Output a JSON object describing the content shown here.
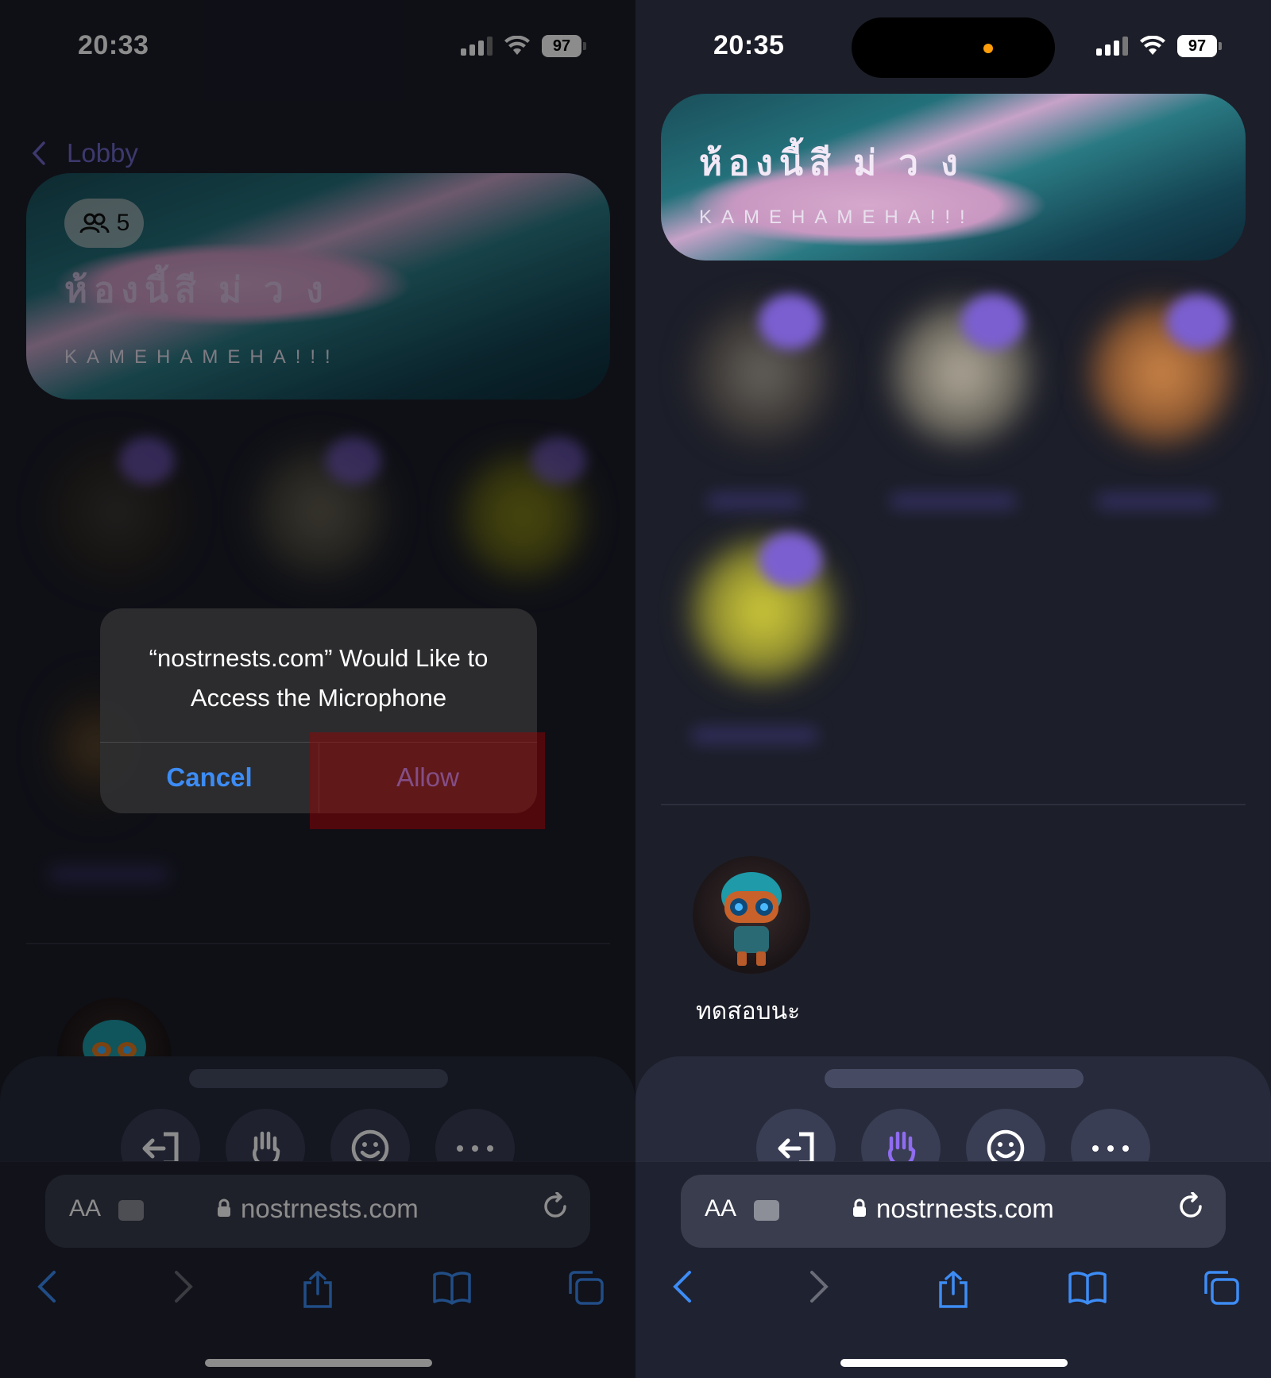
{
  "left": {
    "status": {
      "time": "20:33",
      "battery": "97"
    },
    "nav": {
      "back_label": "Lobby"
    },
    "room": {
      "listener_count": "5",
      "title": "ห้องนี้สี ม่ ว ง",
      "subtitle": "KAMEHAMEHA!!!"
    },
    "dialog": {
      "title": "“nostrnests.com” Would Like to Access the Microphone",
      "cancel_label": "Cancel",
      "allow_label": "Allow"
    },
    "browser": {
      "aa_label": "AA",
      "url": "nostrnests.com"
    }
  },
  "right": {
    "status": {
      "time": "20:35",
      "battery": "97"
    },
    "room": {
      "title": "ห้องนี้สี ม่ ว ง",
      "subtitle": "KAMEHAMEHA!!!"
    },
    "self_user": {
      "name": "ทดสอบนะ"
    },
    "browser": {
      "aa_label": "AA",
      "url": "nostrnests.com"
    }
  },
  "colors": {
    "accent_purple": "#6f68c8",
    "ios_blue": "#3d8cf5",
    "hand_active": "#8f6cf0",
    "alert_highlight": "#a00000"
  },
  "icons": {
    "leave": "leave-icon",
    "hand": "raise-hand-icon",
    "reactions": "emoji-icon",
    "more": "more-icon"
  }
}
